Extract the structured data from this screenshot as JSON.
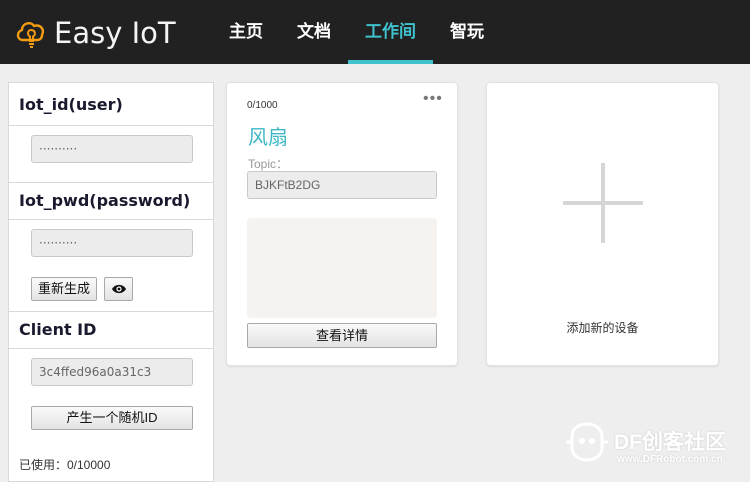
{
  "app": {
    "brand": "Easy IoT"
  },
  "nav": {
    "items": [
      {
        "label": "主页"
      },
      {
        "label": "文档"
      },
      {
        "label": "工作间"
      },
      {
        "label": "智玩"
      }
    ],
    "active": "工作间"
  },
  "credentials": {
    "iot_id_title": "Iot_id(user)",
    "iot_id_value": "··········",
    "iot_pwd_title": "Iot_pwd(password)",
    "iot_pwd_value": "··········",
    "regenerate_label": "重新生成",
    "client_id_title": "Client ID",
    "client_id_value": "3c4ffed96a0a31c3",
    "random_id_label": "产生一个随机ID",
    "used_text": "已使用：0/10000"
  },
  "device": {
    "count": "0/1000",
    "more": "•••",
    "name": "风扇",
    "topic_label": "Topic：",
    "topic_value": "BJKFtB2DG",
    "detail_label": "查看详情"
  },
  "add_device": {
    "label": "添加新的设备"
  },
  "watermark": {
    "text": "DF创客社区",
    "url": "www.DFRobot.com.cn"
  },
  "colors": {
    "nav_bg": "#212121",
    "accent": "#3fc2cd",
    "page_bg": "#eeeeee"
  },
  "icons": {
    "logo": "cloud-bulb-icon",
    "eye": "eye-icon",
    "plus": "plus-icon"
  }
}
